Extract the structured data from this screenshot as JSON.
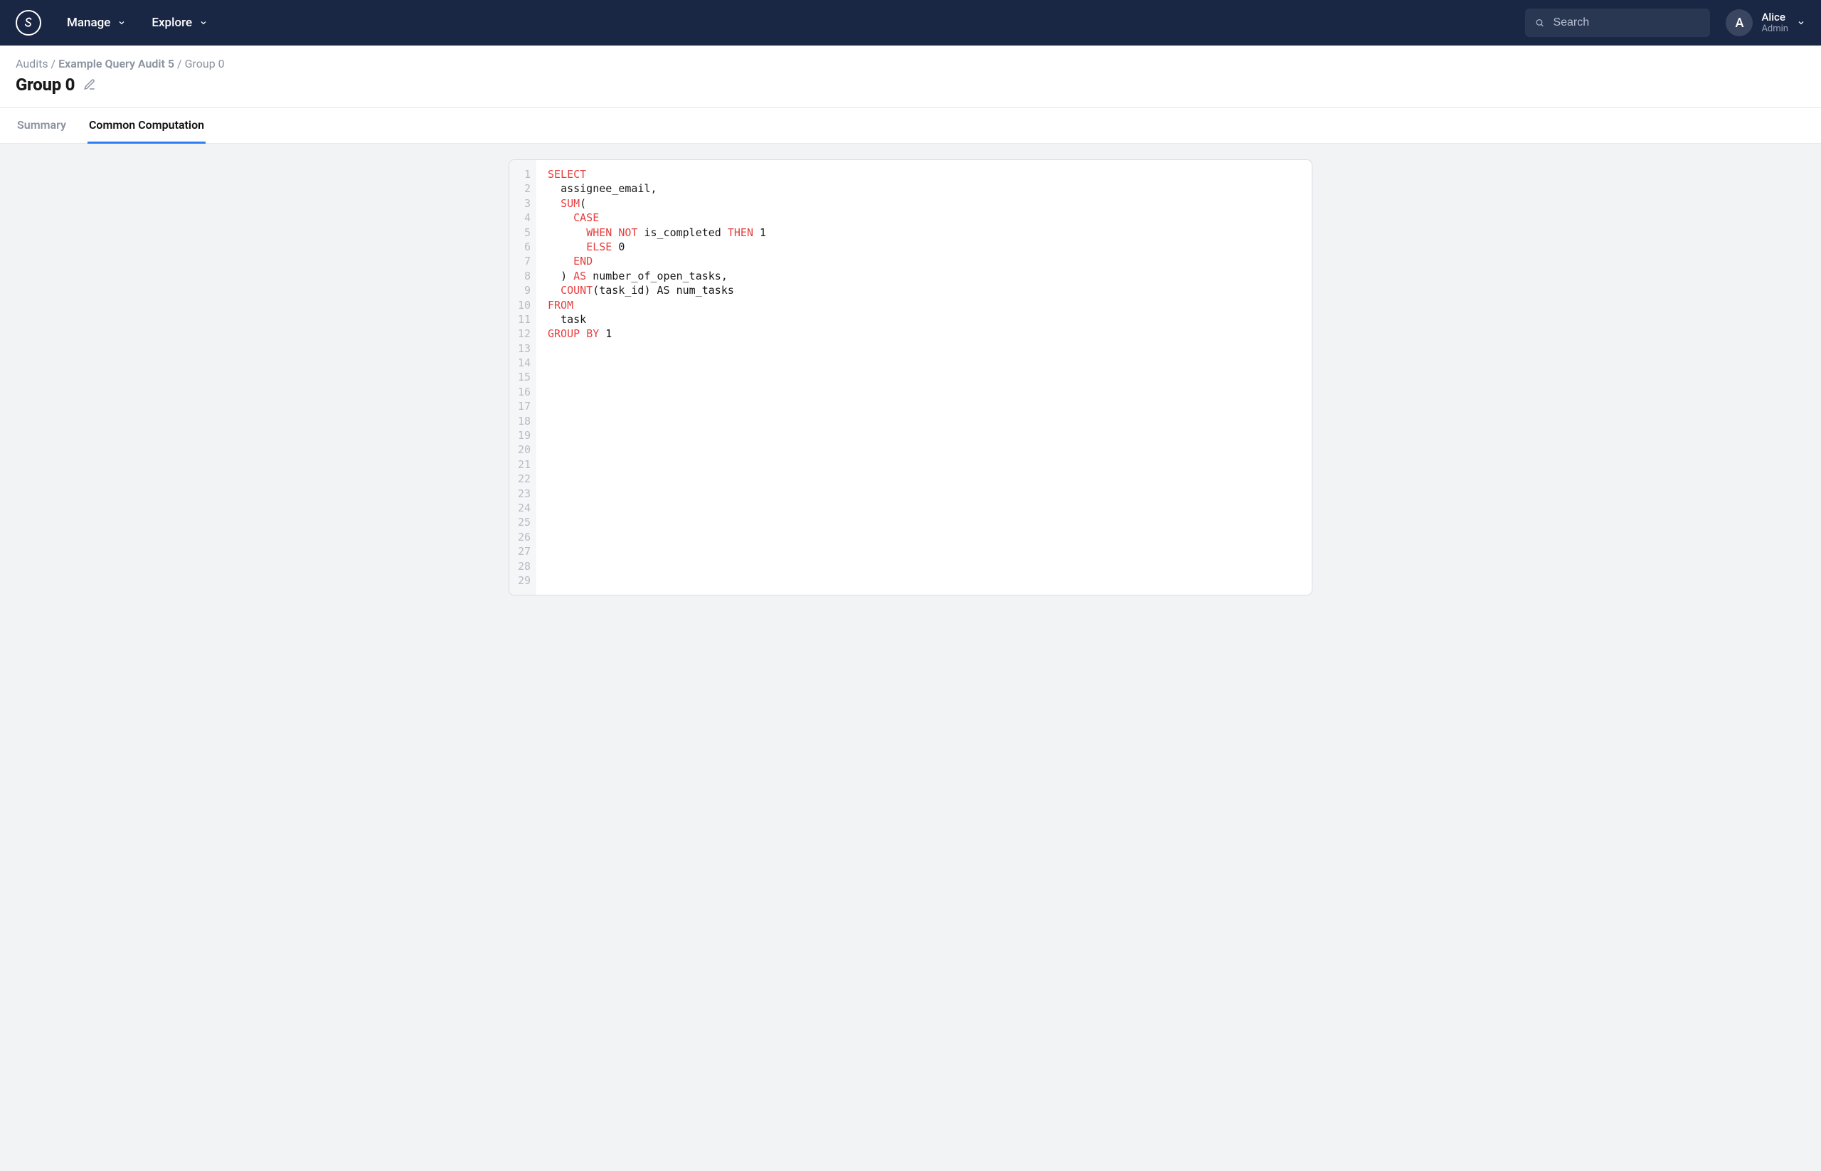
{
  "header": {
    "nav": [
      {
        "label": "Manage"
      },
      {
        "label": "Explore"
      }
    ],
    "search_placeholder": "Search",
    "user": {
      "initial": "A",
      "name": "Alice",
      "role": "Admin"
    }
  },
  "breadcrumb": {
    "items": [
      {
        "label": "Audits",
        "link": true
      },
      {
        "label": "Example Query Audit 5",
        "link": true
      },
      {
        "label": "Group 0",
        "link": false
      }
    ],
    "separator": " / "
  },
  "page_title": "Group 0",
  "tabs": [
    {
      "label": "Summary",
      "active": false
    },
    {
      "label": "Common Computation",
      "active": true
    }
  ],
  "editor": {
    "total_lines": 29,
    "code": [
      [
        {
          "t": "kw",
          "v": "SELECT"
        }
      ],
      [
        {
          "t": "sp",
          "v": "  "
        },
        {
          "t": "id",
          "v": "assignee_email"
        },
        {
          "t": "punct",
          "v": ","
        }
      ],
      [
        {
          "t": "sp",
          "v": "  "
        },
        {
          "t": "kw",
          "v": "SUM"
        },
        {
          "t": "punct",
          "v": "("
        }
      ],
      [
        {
          "t": "sp",
          "v": "    "
        },
        {
          "t": "kw",
          "v": "CASE"
        }
      ],
      [
        {
          "t": "sp",
          "v": "      "
        },
        {
          "t": "kw",
          "v": "WHEN"
        },
        {
          "t": "sp",
          "v": " "
        },
        {
          "t": "kw",
          "v": "NOT"
        },
        {
          "t": "sp",
          "v": " "
        },
        {
          "t": "id",
          "v": "is_completed"
        },
        {
          "t": "sp",
          "v": " "
        },
        {
          "t": "kw",
          "v": "THEN"
        },
        {
          "t": "sp",
          "v": " "
        },
        {
          "t": "num",
          "v": "1"
        }
      ],
      [
        {
          "t": "sp",
          "v": "      "
        },
        {
          "t": "kw",
          "v": "ELSE"
        },
        {
          "t": "sp",
          "v": " "
        },
        {
          "t": "num",
          "v": "0"
        }
      ],
      [
        {
          "t": "sp",
          "v": "    "
        },
        {
          "t": "kw",
          "v": "END"
        }
      ],
      [
        {
          "t": "sp",
          "v": "  "
        },
        {
          "t": "punct",
          "v": ")"
        },
        {
          "t": "sp",
          "v": " "
        },
        {
          "t": "kw",
          "v": "AS"
        },
        {
          "t": "sp",
          "v": " "
        },
        {
          "t": "id",
          "v": "number_of_open_tasks"
        },
        {
          "t": "punct",
          "v": ","
        }
      ],
      [
        {
          "t": "sp",
          "v": "  "
        },
        {
          "t": "kw",
          "v": "COUNT"
        },
        {
          "t": "punct",
          "v": "("
        },
        {
          "t": "id",
          "v": "task_id"
        },
        {
          "t": "punct",
          "v": ")"
        },
        {
          "t": "sp",
          "v": " "
        },
        {
          "t": "id",
          "v": "AS"
        },
        {
          "t": "sp",
          "v": " "
        },
        {
          "t": "id",
          "v": "num_tasks"
        }
      ],
      [
        {
          "t": "kw",
          "v": "FROM"
        }
      ],
      [
        {
          "t": "sp",
          "v": "  "
        },
        {
          "t": "id",
          "v": "task"
        }
      ],
      [
        {
          "t": "kw",
          "v": "GROUP"
        },
        {
          "t": "sp",
          "v": " "
        },
        {
          "t": "kw",
          "v": "BY"
        },
        {
          "t": "sp",
          "v": " "
        },
        {
          "t": "num",
          "v": "1"
        }
      ]
    ]
  }
}
